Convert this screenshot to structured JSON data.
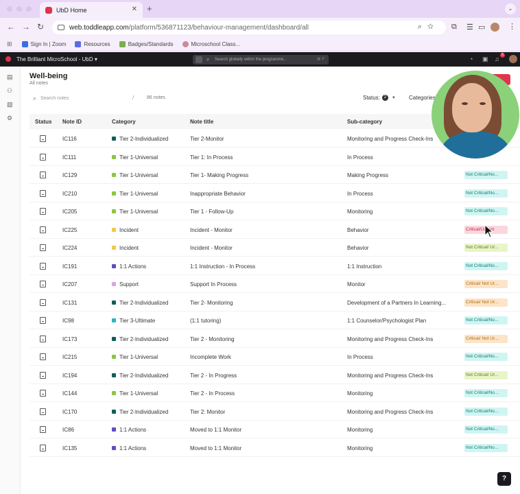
{
  "browser": {
    "tab_title": "UbD Home",
    "url_main": "web.toddleapp.com",
    "url_path": "/platform/536871123/behaviour-management/dashboard/all",
    "bookmarks": [
      "Sign In | Zoom",
      "Resources",
      "Badges/Standards",
      "Microschool Class..."
    ],
    "bookmark_colors": [
      "#3b6fe0",
      "#5a6ae8",
      "#7ab04a",
      "#c98a9a"
    ]
  },
  "app": {
    "school_title": "The Brilliant MicroSchool - UbD",
    "search_placeholder": "Search globally within the programme..",
    "search_kbd": "⌘ F",
    "notif_count": "5"
  },
  "page": {
    "title": "Well-being",
    "subtitle": "All notes",
    "search_placeholder": "Search notes",
    "slash": "/",
    "count": "86 notes",
    "status_filter_label": "Status:",
    "status_filter_count": "2",
    "category_filter_label": "Categories:"
  },
  "table": {
    "columns": [
      "Status",
      "Note ID",
      "Category",
      "Note title",
      "Sub-category"
    ],
    "rows": [
      {
        "id": "IC116",
        "category": "Tier 2-Individualized",
        "cat_color": "#0f5f5a",
        "title": "Tier 2-Monitor",
        "sub": "Monitoring and Progress Check-Ins",
        "tag": "",
        "tag_class": ""
      },
      {
        "id": "IC111",
        "category": "Tier 1-Universal",
        "cat_color": "#8cc63f",
        "title": "Tier 1: In Process",
        "sub": "In Process",
        "tag": "",
        "tag_class": ""
      },
      {
        "id": "IC129",
        "category": "Tier 1-Universal",
        "cat_color": "#8cc63f",
        "title": "Tier 1- Making Progress",
        "sub": "Making Progress",
        "tag": "Not Critical/No...",
        "tag_class": "nc"
      },
      {
        "id": "IC210",
        "category": "Tier 1-Universal",
        "cat_color": "#8cc63f",
        "title": "Inappropriate Behavior",
        "sub": "In Process",
        "tag": "Not Critical/No...",
        "tag_class": "nc"
      },
      {
        "id": "IC205",
        "category": "Tier 1-Universal",
        "cat_color": "#8cc63f",
        "title": "Tier 1 - Follow-Up",
        "sub": "Monitoring",
        "tag": "Not Critical/No...",
        "tag_class": "nc"
      },
      {
        "id": "IC225",
        "category": "Incident",
        "cat_color": "#f2c94c",
        "title": "Incident - Monitor",
        "sub": "Behavior",
        "tag": "Critical/Urgent",
        "tag_class": "crp"
      },
      {
        "id": "IC224",
        "category": "Incident",
        "cat_color": "#f2c94c",
        "title": "Incident - Monitor",
        "sub": "Behavior",
        "tag": "Not Critical/ Ur...",
        "tag_class": "ncu"
      },
      {
        "id": "IC191",
        "category": "1:1 Actions",
        "cat_color": "#5a4fc4",
        "title": "1:1 Instruction - In Process",
        "sub": "1:1 Instruction",
        "tag": "Not Critical/No...",
        "tag_class": "nc"
      },
      {
        "id": "IC207",
        "category": "Support",
        "cat_color": "#d8a6e0",
        "title": "Support In Process",
        "sub": "Monitor",
        "tag": "Critical/ Not Ur...",
        "tag_class": "cr"
      },
      {
        "id": "IC131",
        "category": "Tier 2-Individualized",
        "cat_color": "#0f5f5a",
        "title": "Tier 2- Monitoring",
        "sub": "Development of a Partners In Learning...",
        "tag": "Critical/ Not Ur...",
        "tag_class": "cr"
      },
      {
        "id": "IC98",
        "category": "Tier 3-Ultimate",
        "cat_color": "#2ab3c9",
        "title": "(1:1 tutoring)",
        "sub": "1:1 Counselor/Psychologist Plan",
        "tag": "Not Critical/No...",
        "tag_class": "nc"
      },
      {
        "id": "IC173",
        "category": "Tier 2-Individualized",
        "cat_color": "#0f5f5a",
        "title": "Tier 2 - Monitoring",
        "sub": "Monitoring and Progress Check-Ins",
        "tag": "Critical/ Not Ur...",
        "tag_class": "cr"
      },
      {
        "id": "IC215",
        "category": "Tier 1-Universal",
        "cat_color": "#8cc63f",
        "title": "Incomplete Work",
        "sub": "In Process",
        "tag": "Not Critical/No...",
        "tag_class": "nc"
      },
      {
        "id": "IC194",
        "category": "Tier 2-Individualized",
        "cat_color": "#0f5f5a",
        "title": "Tier 2 - In Progress",
        "sub": "Monitoring and Progress Check-Ins",
        "tag": "Not Critical/ Ur...",
        "tag_class": "ncu"
      },
      {
        "id": "IC144",
        "category": "Tier 1-Universal",
        "cat_color": "#8cc63f",
        "title": "Tier 2 - In Process",
        "sub": "Monitoring",
        "tag": "Not Critical/No...",
        "tag_class": "nc"
      },
      {
        "id": "IC170",
        "category": "Tier 2-Individualized",
        "cat_color": "#0f5f5a",
        "title": "Tier 2: Monitor",
        "sub": "Monitoring and Progress Check-Ins",
        "tag": "Not Critical/No...",
        "tag_class": "nc"
      },
      {
        "id": "IC86",
        "category": "1:1 Actions",
        "cat_color": "#5a4fc4",
        "title": "Moved to 1:1 Monitor",
        "sub": "Monitoring",
        "tag": "Not Critical/No...",
        "tag_class": "nc"
      },
      {
        "id": "IC135",
        "category": "1:1 Actions",
        "cat_color": "#5a4fc4",
        "title": "Moved to 1:1 Monitor",
        "sub": "Monitoring",
        "tag": "Not Critical/No...",
        "tag_class": "nc"
      }
    ]
  },
  "help_label": "?"
}
